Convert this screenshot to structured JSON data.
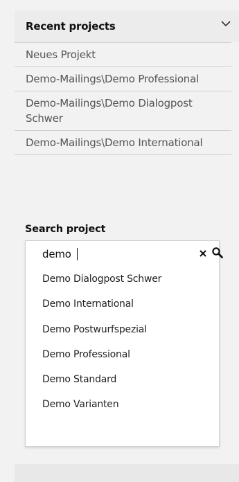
{
  "recent": {
    "title": "Recent projects",
    "items": [
      "Neues Projekt",
      "Demo-Mailings\\Demo Professional",
      "Demo-Mailings\\Demo Dialogpost Schwer",
      "Demo-Mailings\\Demo International"
    ]
  },
  "search": {
    "label": "Search project",
    "value": "demo",
    "results": [
      "Demo Dialogpost Schwer",
      "Demo International",
      "Demo Postwurfspezial",
      "Demo Professional",
      "Demo Standard",
      "Demo Varianten"
    ]
  },
  "icons": {
    "collapse": "chevron-down-icon",
    "clear": "close-icon",
    "search": "search-icon"
  }
}
